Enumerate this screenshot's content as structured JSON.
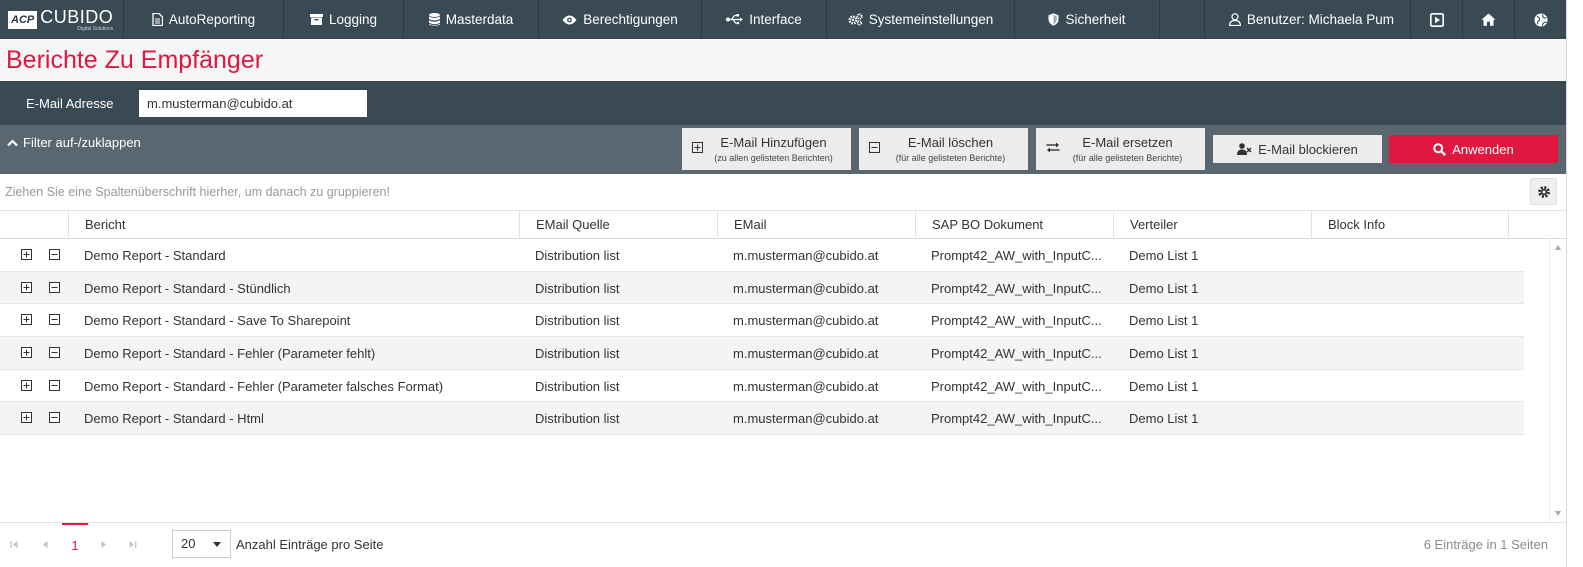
{
  "brand": {
    "logo": "ACP",
    "name": "CUBIDO",
    "subtitle": "Digital Solutions"
  },
  "nav": {
    "items": [
      {
        "label": "AutoReporting",
        "icon": "document-icon"
      },
      {
        "label": "Logging",
        "icon": "archive-icon"
      },
      {
        "label": "Masterdata",
        "icon": "database-icon"
      },
      {
        "label": "Berechtigungen",
        "icon": "eye-icon"
      },
      {
        "label": "Interface",
        "icon": "usb-icon"
      },
      {
        "label": "Systemeinstellungen",
        "icon": "cogs-icon"
      },
      {
        "label": "Sicherheit",
        "icon": "shield-icon"
      }
    ],
    "user_label": "Benutzer: Michaela Pum"
  },
  "page": {
    "title": "Berichte Zu Empfänger"
  },
  "email": {
    "label": "E-Mail Adresse",
    "value": "m.musterman@cubido.at"
  },
  "filter": {
    "toggle_label": "Filter auf-/zuklappen",
    "add_label": "E-Mail Hinzufügen",
    "add_sub": "(zu allen gelisteten Berichten)",
    "delete_label": "E-Mail löschen",
    "delete_sub": "(für alle gelisteten Berichte)",
    "replace_label": "E-Mail ersetzen",
    "replace_sub": "(für alle gelisteten Berichte)",
    "block_label": "E-Mail blockieren",
    "apply_label": "Anwenden"
  },
  "grid": {
    "group_hint": "Ziehen Sie eine Spaltenüberschrift hierher, um danach zu gruppieren!",
    "columns": [
      "Bericht",
      "EMail Quelle",
      "EMail",
      "SAP BO Dokument",
      "Verteiler",
      "Block Info"
    ],
    "rows": [
      {
        "report": "Demo Report - Standard",
        "source": "Distribution list",
        "email": "m.musterman@cubido.at",
        "doc": "Prompt42_AW_with_InputC...",
        "list": "Demo List 1",
        "block": ""
      },
      {
        "report": "Demo Report - Standard - Stündlich",
        "source": "Distribution list",
        "email": "m.musterman@cubido.at",
        "doc": "Prompt42_AW_with_InputC...",
        "list": "Demo List 1",
        "block": ""
      },
      {
        "report": "Demo Report - Standard - Save To Sharepoint",
        "source": "Distribution list",
        "email": "m.musterman@cubido.at",
        "doc": "Prompt42_AW_with_InputC...",
        "list": "Demo List 1",
        "block": ""
      },
      {
        "report": "Demo Report - Standard - Fehler (Parameter fehlt)",
        "source": "Distribution list",
        "email": "m.musterman@cubido.at",
        "doc": "Prompt42_AW_with_InputC...",
        "list": "Demo List 1",
        "block": ""
      },
      {
        "report": "Demo Report - Standard - Fehler (Parameter falsches Format)",
        "source": "Distribution list",
        "email": "m.musterman@cubido.at",
        "doc": "Prompt42_AW_with_InputC...",
        "list": "Demo List 1",
        "block": ""
      },
      {
        "report": "Demo Report - Standard - Html",
        "source": "Distribution list",
        "email": "m.musterman@cubido.at",
        "doc": "Prompt42_AW_with_InputC...",
        "list": "Demo List 1",
        "block": ""
      }
    ]
  },
  "pager": {
    "current_page": "1",
    "page_size": "20",
    "page_size_label": "Anzahl Einträge pro Seite",
    "info": "6 Einträge in 1 Seiten"
  },
  "colors": {
    "accent": "#e2173f",
    "nav_bg": "#3a4a54",
    "filter_bg": "#5a6770"
  }
}
